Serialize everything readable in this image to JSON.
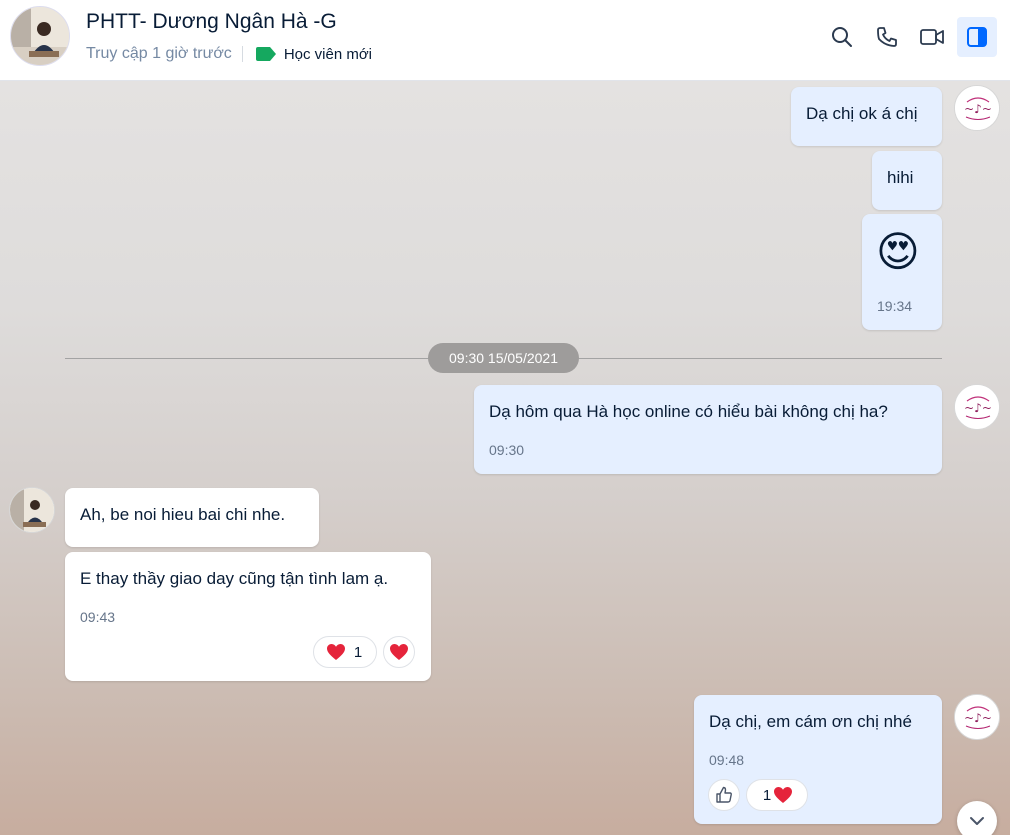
{
  "header": {
    "title": "PHTT- Dương Ngân Hà -G",
    "status": "Truy cập 1 giờ trước",
    "tag_label": "Học viên mới",
    "tag_color": "#15a85f",
    "icons": [
      "search-icon",
      "phone-icon",
      "video-call-icon",
      "toggle-sidebar-icon"
    ]
  },
  "conversation": {
    "messages": [
      {
        "sender": "me",
        "text": "Dạ chị ok á chị"
      },
      {
        "sender": "me",
        "text": "hihi"
      },
      {
        "sender": "me",
        "emoji": "😍",
        "time": "19:34"
      },
      {
        "sender": "me",
        "text": "Dạ hôm qua Hà học online có hiểu bài không chị ha?",
        "time": "09:30"
      },
      {
        "sender": "them",
        "text": "Ah, be noi hieu bai chi nhe."
      },
      {
        "sender": "them",
        "text": "E thay thầy giao day cũng tận tình lam ạ.",
        "time": "09:43",
        "reaction_count": "1"
      },
      {
        "sender": "me",
        "text": "Dạ chị, em cám ơn chị nhé",
        "time": "09:48",
        "reaction_count": "1"
      }
    ],
    "date_divider": "09:30 15/05/2021"
  },
  "colors": {
    "my_bubble": "#e5efff",
    "their_bubble": "#ffffff",
    "heart": "#e5243b",
    "accent": "#0068ff"
  }
}
